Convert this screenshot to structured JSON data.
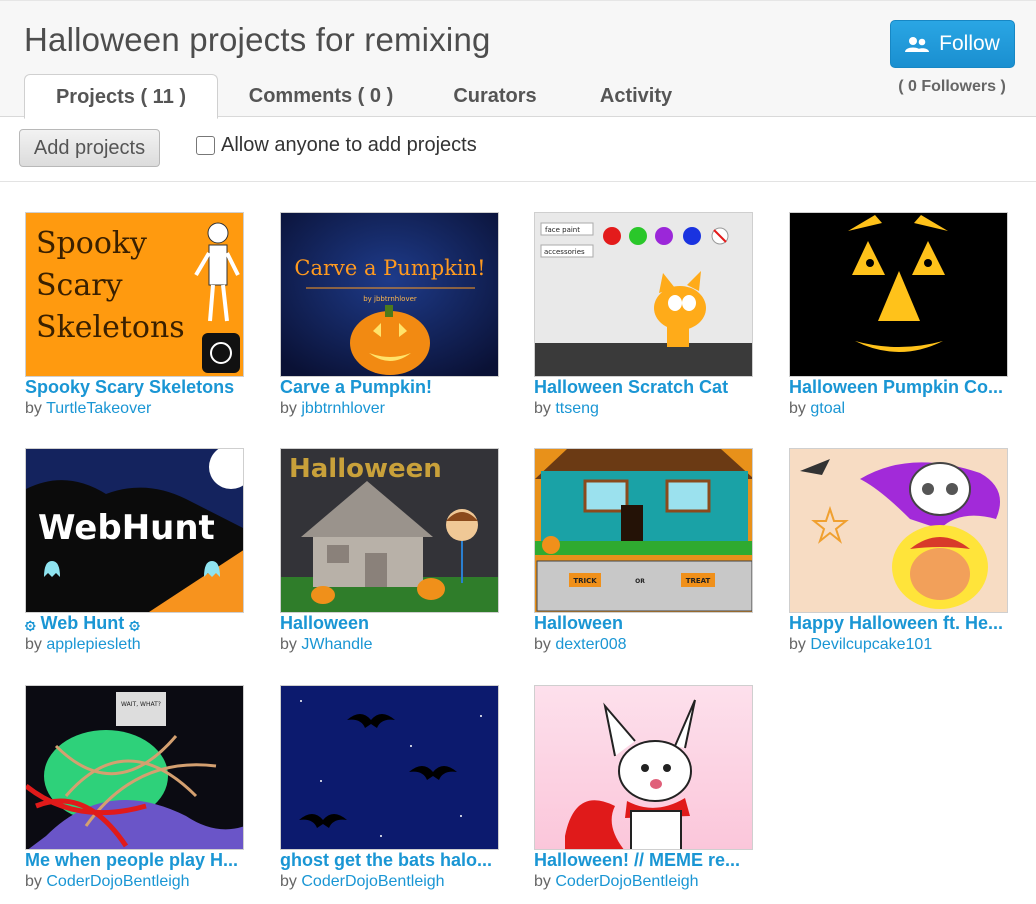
{
  "studio": {
    "title": "Halloween projects for remixing",
    "follow_label": "Follow",
    "followers": "( 0 Followers )"
  },
  "tabs": [
    {
      "label": "Projects ( 11 )",
      "active": true
    },
    {
      "label": "Comments ( 0 )",
      "active": false
    },
    {
      "label": "Curators",
      "active": false
    },
    {
      "label": "Activity",
      "active": false
    }
  ],
  "toolbar": {
    "add_projects_label": "Add projects",
    "allow_label": "Allow anyone to add projects",
    "allow_checked": false
  },
  "projects": [
    {
      "title": "Spooky Scary Skeletons",
      "by": "by",
      "author": "TurtleTakeover",
      "thumb_text": [
        "Spooky",
        "Scary",
        "Skeletons"
      ]
    },
    {
      "title": "Carve a Pumpkin!",
      "by": "by",
      "author": "jbbtrnhlover",
      "thumb_text": [
        "Carve a Pumpkin!",
        "by jbbtrnhlover"
      ]
    },
    {
      "title": "Halloween Scratch Cat",
      "by": "by",
      "author": "ttseng",
      "thumb_text": [
        "face paint",
        "accessories"
      ]
    },
    {
      "title": "Halloween Pumpkin Co...",
      "by": "by",
      "author": "gtoal"
    },
    {
      "title": "۞ Web Hunt ۞",
      "by": "by",
      "author": "applepiesleth",
      "thumb_text": [
        "WebHunt"
      ]
    },
    {
      "title": "Halloween",
      "by": "by",
      "author": "JWhandle",
      "thumb_text": [
        "Halloween"
      ]
    },
    {
      "title": "Halloween",
      "by": "by",
      "author": "dexter008",
      "thumb_text": [
        "TRICK",
        "OR",
        "TREAT"
      ]
    },
    {
      "title": "Happy Halloween ft. He...",
      "by": "by",
      "author": "Devilcupcake101"
    },
    {
      "title": "Me when people play H...",
      "by": "by",
      "author": "CoderDojoBentleigh",
      "thumb_text": [
        "WAIT, WHAT?"
      ]
    },
    {
      "title": "ghost get the bats halo...",
      "by": "by",
      "author": "CoderDojoBentleigh"
    },
    {
      "title": "Halloween! // MEME re...",
      "by": "by",
      "author": "CoderDojoBentleigh"
    }
  ],
  "colors": {
    "link": "#1a96d4",
    "follow_button": "#2aa6e4",
    "header_bg": "#f7f7f7"
  }
}
